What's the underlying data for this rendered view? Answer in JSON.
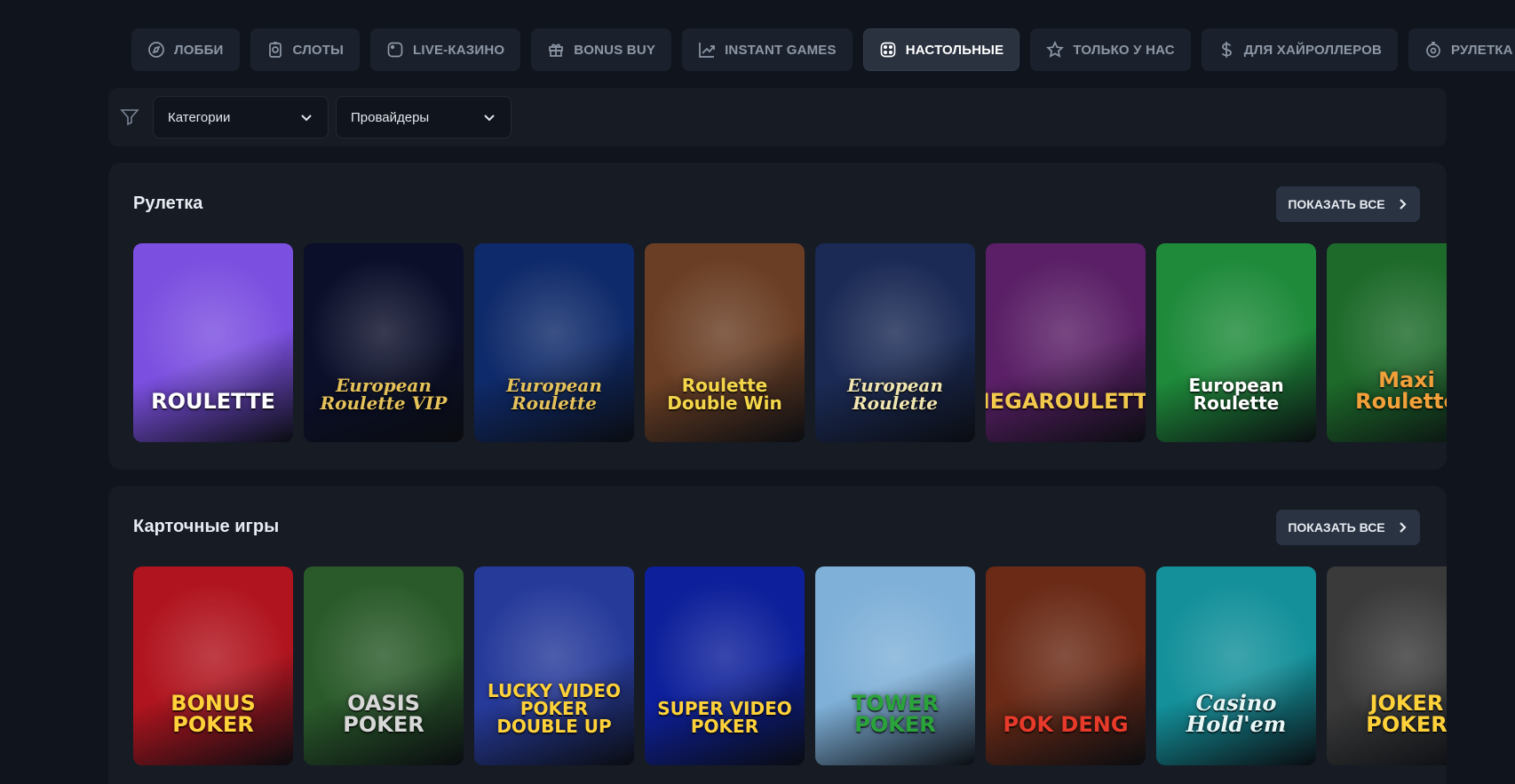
{
  "nav": {
    "items": [
      {
        "label": "ЛОББИ",
        "icon": "compass-icon"
      },
      {
        "label": "СЛОТЫ",
        "icon": "slot-icon"
      },
      {
        "label": "LIVE-КАЗИНО",
        "icon": "live-icon"
      },
      {
        "label": "BONUS BUY",
        "icon": "gift-icon"
      },
      {
        "label": "INSTANT GAMES",
        "icon": "chart-up-icon"
      },
      {
        "label": "НАСТОЛЬНЫЕ",
        "icon": "dice-icon",
        "active": true
      },
      {
        "label": "ТОЛЬКО У НАС",
        "icon": "star-icon"
      },
      {
        "label": "ДЛЯ ХАЙРОЛЛЕРОВ",
        "icon": "dollar-icon"
      },
      {
        "label": "РУЛЕТКА",
        "icon": "roulette-icon"
      }
    ]
  },
  "filters": {
    "categories": "Категории",
    "providers": "Провайдеры"
  },
  "sections": [
    {
      "title": "Рулетка",
      "show_all": "ПОКАЗАТЬ ВСЕ",
      "games": [
        {
          "label": "ROULETTE",
          "bg": "#7b4fe0",
          "fg": "#ffffff"
        },
        {
          "label": "European Roulette VIP",
          "bg": "#0b0f2a",
          "fg": "#e6c25a",
          "script": true
        },
        {
          "label": "European Roulette",
          "bg": "#0f2a6a",
          "fg": "#e6c25a",
          "script": true
        },
        {
          "label": "Roulette Double Win",
          "bg": "#6a3e24",
          "fg": "#f4d64a"
        },
        {
          "label": "European Roulette",
          "bg": "#1b2a55",
          "fg": "#f2e6b0",
          "script": true
        },
        {
          "label": "MEGAROULETTE",
          "bg": "#5a1f66",
          "fg": "#f2c94c"
        },
        {
          "label": "European Roulette",
          "bg": "#1e8a3a",
          "fg": "#ffffff"
        },
        {
          "label": "Maxi Roulette",
          "bg": "#1d6a2a",
          "fg": "#f2a03a"
        }
      ]
    },
    {
      "title": "Карточные игры",
      "show_all": "ПОКАЗАТЬ ВСЕ",
      "games": [
        {
          "label": "BONUS POKER",
          "bg": "#b0141e",
          "fg": "#ffd23a"
        },
        {
          "label": "OASIS POKER",
          "bg": "#2a5a2a",
          "fg": "#d8d8d8"
        },
        {
          "label": "LUCKY VIDEO POKER DOUBLE UP",
          "bg": "#263a9a",
          "fg": "#ffd23a"
        },
        {
          "label": "SUPER VIDEO POKER",
          "bg": "#0d1f9a",
          "fg": "#ffd23a"
        },
        {
          "label": "TOWER POKER",
          "bg": "#7fb0d8",
          "fg": "#2aa33a"
        },
        {
          "label": "POK DENG",
          "bg": "#6a2a16",
          "fg": "#e83a2a"
        },
        {
          "label": "Casino Hold'em",
          "bg": "#13909a",
          "fg": "#e8f6f6",
          "script": true
        },
        {
          "label": "JOKER POKER",
          "bg": "#3a3a3a",
          "fg": "#ffd23a"
        }
      ]
    }
  ],
  "colors": {
    "page_bg": "#10141c",
    "panel_bg": "#161b24",
    "nav_bg": "#1b212c",
    "nav_active_bg": "#2a3240",
    "button_bg": "#2a3342"
  }
}
